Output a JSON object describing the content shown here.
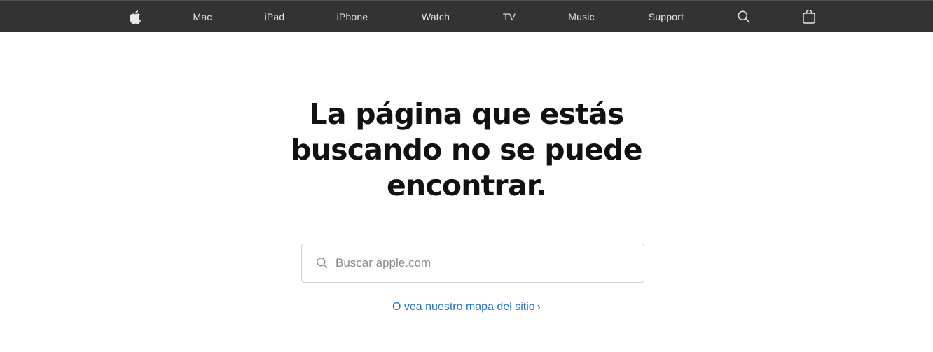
{
  "nav": {
    "logo_icon": "apple-logo-icon",
    "items": [
      {
        "label": "Mac"
      },
      {
        "label": "iPad"
      },
      {
        "label": "iPhone"
      },
      {
        "label": "Watch"
      },
      {
        "label": "TV"
      },
      {
        "label": "Music"
      },
      {
        "label": "Support"
      }
    ],
    "search_icon": "search-icon",
    "bag_icon": "shopping-bag-icon",
    "background": "#333333",
    "text_color": "#e8e8e8"
  },
  "main": {
    "headline_lines": [
      "La página que estás",
      "buscando no se puede",
      "encontrar."
    ],
    "search": {
      "placeholder": "Buscar apple.com",
      "value": ""
    },
    "sitemap_link": {
      "label": "O vea nuestro mapa del sitio",
      "chevron": "›",
      "color": "#2271c6"
    }
  }
}
